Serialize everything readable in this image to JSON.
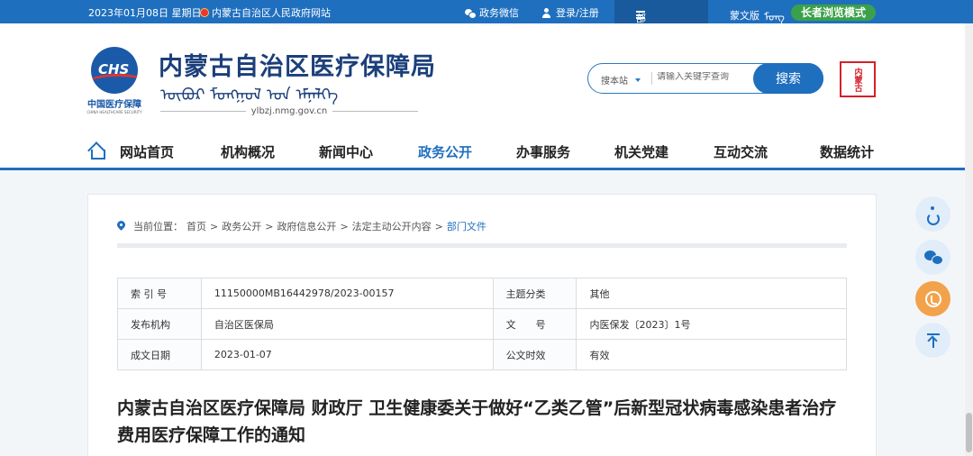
{
  "topbar": {
    "date": "2023年01月08日 星期日",
    "gov_link": "内蒙古自治区人民政府网站",
    "wechat": "政务微信",
    "login": "登录/注册",
    "site_nav": "部门网站导航",
    "mongol_version": "蒙文版",
    "mongol_script": "ᠮᠣᠩ",
    "elder_mode": "长者浏览模式"
  },
  "header": {
    "logo_cn": "中国医疗保障",
    "logo_en": "CHINA HEALTHCARE SECURITY",
    "logo_mark": "CHS",
    "title": "内蒙古自治区医疗保障局",
    "mongol_title": "ᠥᠪᠥᠷ ᠮᠣᠩᠭᠣᠯ ᠤᠨ ᠡᠮᠨᠡᠯᠭᠡ",
    "domain": "ylbzj.nmg.gov.cn",
    "seal_text": "内蒙古"
  },
  "search": {
    "scope": "搜本站",
    "placeholder": "请输入关键字查询",
    "button": "搜索"
  },
  "nav": {
    "items": [
      "网站首页",
      "机构概况",
      "新闻中心",
      "政务公开",
      "办事服务",
      "机关党建",
      "互动交流",
      "数据统计"
    ],
    "active_index": 3
  },
  "breadcrumb": {
    "prefix": "当前位置：",
    "items": [
      "首页",
      "政务公开",
      "政府信息公开",
      "法定主动公开内容",
      "部门文件"
    ],
    "separator": ">"
  },
  "meta": {
    "rows": [
      [
        {
          "k": "索 引 号",
          "v": "11150000MB16442978/2023-00157"
        },
        {
          "k": "主题分类",
          "v": "其他"
        }
      ],
      [
        {
          "k": "发布机构",
          "v": "自治区医保局"
        },
        {
          "k": "文　　号",
          "v": "内医保发〔2023〕1号"
        }
      ],
      [
        {
          "k": "成文日期",
          "v": "2023-01-07"
        },
        {
          "k": "公文时效",
          "v": "有效"
        }
      ]
    ]
  },
  "document": {
    "title": "内蒙古自治区医疗保障局 财政厅 卫生健康委关于做好“乙类乙管”后新型冠状病毒感染患者治疗费用医疗保障工作的通知"
  },
  "colors": {
    "primary": "#1f6fbf",
    "elder_green": "#3aa14a",
    "phone_orange": "#f3a24c",
    "seal_red": "#d5202a"
  }
}
